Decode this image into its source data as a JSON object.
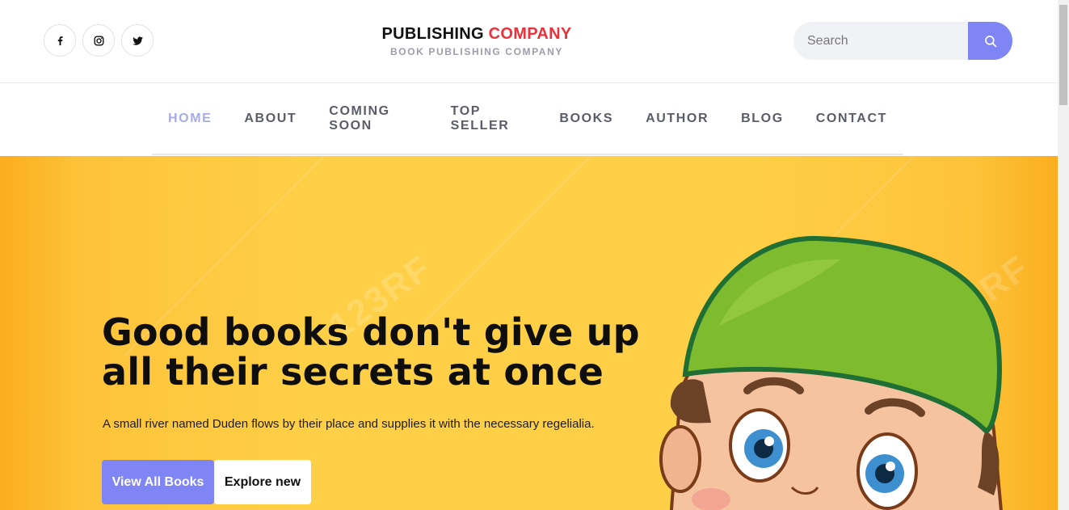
{
  "header": {
    "social": [
      {
        "icon": "facebook-icon"
      },
      {
        "icon": "instagram-icon"
      },
      {
        "icon": "twitter-icon"
      }
    ],
    "brand": {
      "name_main": "PUBLISHING",
      "name_accent": "COMPANY",
      "tagline": "BOOK PUBLISHING COMPANY"
    },
    "search": {
      "placeholder": "Search",
      "value": "",
      "icon": "search-icon"
    }
  },
  "nav": {
    "items": [
      {
        "label": "HOME",
        "active": true
      },
      {
        "label": "ABOUT"
      },
      {
        "label": "COMING SOON"
      },
      {
        "label": "TOP SELLER"
      },
      {
        "label": "BOOKS"
      },
      {
        "label": "AUTHOR"
      },
      {
        "label": "BLOG"
      },
      {
        "label": "CONTACT"
      }
    ]
  },
  "hero": {
    "title_line1": "Good books don't give up",
    "title_line2": "all their secrets at once",
    "subtitle": "A small river named Duden flows by their place and supplies it with the necessary regelialia.",
    "primary_button": "View All Books",
    "secondary_button": "Explore new",
    "watermark": "123RF"
  },
  "colors": {
    "accent": "#7f85f5",
    "brand_red": "#e8323c",
    "hero_yellow": "#ffd047",
    "nav_active": "#a8abe8"
  }
}
